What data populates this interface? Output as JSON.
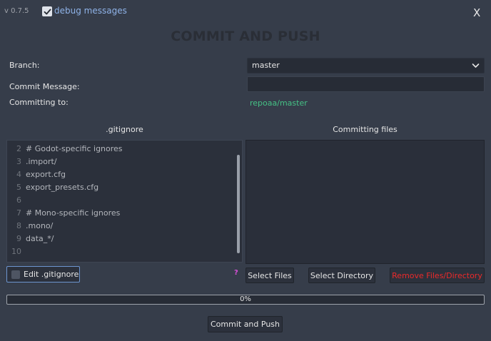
{
  "header": {
    "version": "v 0.7.5",
    "debug_label": "debug messages",
    "debug_checked": true,
    "close_label": "X"
  },
  "title": "COMMIT AND PUSH",
  "form": {
    "branch_label": "Branch:",
    "branch_value": "master",
    "commit_message_label": "Commit Message:",
    "commit_message_value": "",
    "committing_to_label": "Committing to:",
    "committing_to_value": "repoaa/master"
  },
  "gitignore": {
    "heading": ".gitignore",
    "lines": [
      {
        "num": "2",
        "text": "# Godot-specific ignores"
      },
      {
        "num": "3",
        "text": ".import/"
      },
      {
        "num": "4",
        "text": "export.cfg"
      },
      {
        "num": "5",
        "text": "export_presets.cfg"
      },
      {
        "num": "6",
        "text": ""
      },
      {
        "num": "7",
        "text": "# Mono-specific ignores"
      },
      {
        "num": "8",
        "text": ".mono/"
      },
      {
        "num": "9",
        "text": "data_*/"
      },
      {
        "num": "10",
        "text": ""
      }
    ],
    "edit_label": "Edit .gitignore",
    "help_label": "?"
  },
  "files": {
    "heading": "Committing files",
    "select_files_label": "Select Files",
    "select_directory_label": "Select Directory",
    "remove_label": "Remove Files/Directory"
  },
  "progress": {
    "label": "0%",
    "value": 0
  },
  "commit_push_label": "Commit and Push",
  "colors": {
    "background": "#363d4a",
    "accent": "#6d95cf",
    "green": "#45c185",
    "danger": "#ec2a2a",
    "help": "#d94fd9"
  }
}
